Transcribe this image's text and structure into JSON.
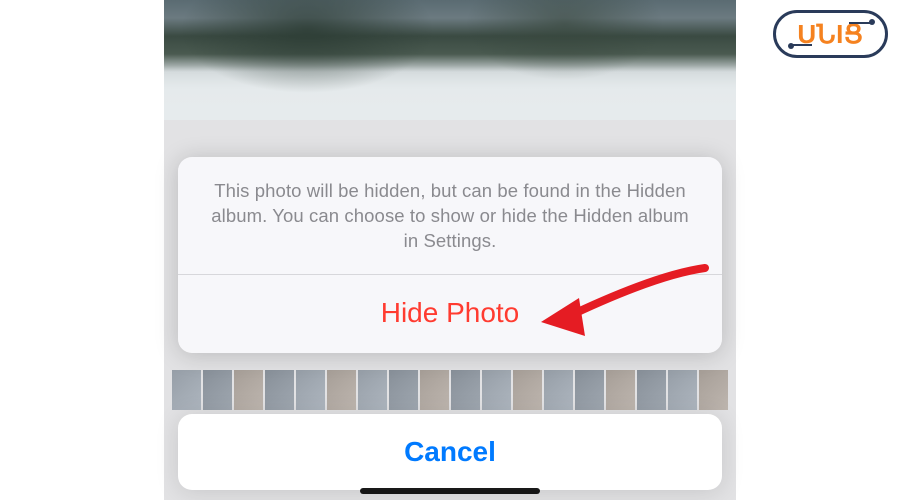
{
  "sheet": {
    "message": "This photo will be hidden, but can be found in the Hidden album. You can choose to show or hide the Hidden album in Settings.",
    "hide_label": "Hide Photo",
    "cancel_label": "Cancel"
  },
  "annotation": {
    "arrow_color": "#e51c23"
  },
  "logo": {
    "text": "UՆIՑ"
  }
}
